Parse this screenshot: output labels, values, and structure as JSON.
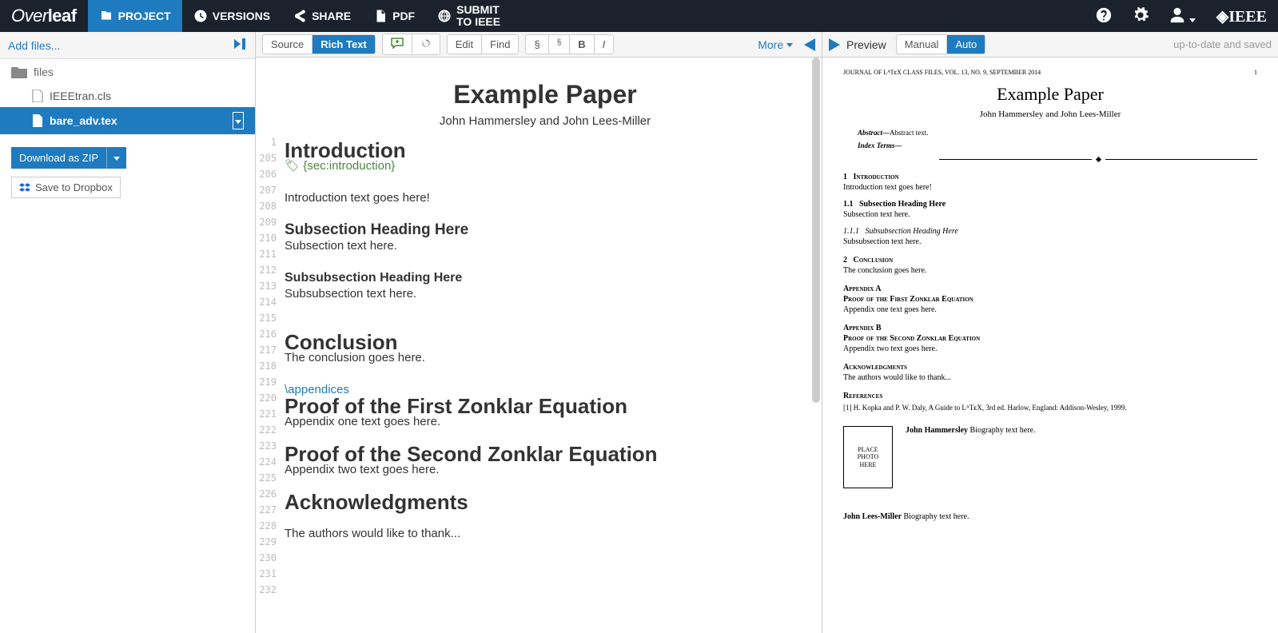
{
  "logo_thin": "Over",
  "logo_bold": "leaf",
  "nav": {
    "project": "PROJECT",
    "versions": "VERSIONS",
    "share": "SHARE",
    "pdf": "PDF",
    "submit1": "SUBMIT",
    "submit2": "TO IEEE"
  },
  "ieee": "◈IEEE",
  "sidebar": {
    "add": "Add files...",
    "folder": "files",
    "f1": "IEEEtran.cls",
    "f2": "bare_adv.tex",
    "zip": "Download as ZIP",
    "dropbox": "Save to Dropbox"
  },
  "tb": {
    "source": "Source",
    "rich": "Rich Text",
    "edit": "Edit",
    "find": "Find",
    "sec": "§",
    "sub": "§",
    "b": "B",
    "i": "I",
    "more": "More"
  },
  "gut": [
    "1",
    "205",
    "206",
    "207",
    "208",
    "209",
    "210",
    "211",
    "212",
    "213",
    "214",
    "215",
    "216",
    "217",
    "218",
    "219",
    "220",
    "221",
    "222",
    "223",
    "224",
    "225",
    "226",
    "227",
    "228",
    "229",
    "230",
    "231",
    "232"
  ],
  "ed": {
    "title": "Example Paper",
    "authors": "John Hammersley and John Lees-Miller",
    "intro_h": "Introduction",
    "intro_tag": "{sec:introduction}",
    "intro_t": "Introduction text goes here!",
    "sub_h": "Subsection Heading Here",
    "sub_t": "Subsection text here.",
    "subsub_h": "Subsubsection Heading Here",
    "subsub_t": "Subsubsection text here.",
    "conc_h": "Conclusion",
    "conc_t": "The conclusion goes here.",
    "app_cmd": "\\appendices",
    "z1_h": "Proof of the First Zonklar Equation",
    "z1_t": "Appendix one text goes here.",
    "z2_h": "Proof of the Second Zonklar Equation",
    "z2_t": "Appendix two text goes here.",
    "ack_h": "Acknowledgments",
    "ack_t": "The authors would like to thank..."
  },
  "prev": {
    "label": "Preview",
    "manual": "Manual",
    "auto": "Auto",
    "status": "up-to-date and saved"
  },
  "pdf": {
    "journal": "JOURNAL OF LᴬTᴇX CLASS FILES, VOL. 13, NO. 9, SEPTEMBER 2014",
    "page": "1",
    "title": "Example Paper",
    "authors": "John Hammersley and John Lees-Miller",
    "abs_l": "Abstract—",
    "abs_t": "Abstract text.",
    "idx_l": "Index Terms—",
    "s1": "1",
    "s1t": "Introduction",
    "s1b": "Introduction text goes here!",
    "s11": "1.1",
    "s11t": "Subsection Heading Here",
    "s11b": "Subsection text here.",
    "s111": "1.1.1",
    "s111t": "Subsubsection Heading Here",
    "s111b": "Subsubsection text here.",
    "s2": "2",
    "s2t": "Conclusion",
    "s2b": "The conclusion goes here.",
    "aA": "Appendix A",
    "aAt": "Proof of the First Zonklar Equation",
    "aAb": "Appendix one text goes here.",
    "aB": "Appendix B",
    "aBt": "Proof of the Second Zonklar Equation",
    "aBb": "Appendix two text goes here.",
    "ack": "Acknowledgments",
    "ackb": "The authors would like to thank...",
    "ref": "References",
    "ref1": "[1]  H. Kopka and P. W. Daly, A Guide to LᴬTᴇX, 3rd ed.  Harlow, England: Addison-Wesley, 1999.",
    "photo": "PLACE\nPHOTO\nHERE",
    "bio1n": "John Hammersley",
    "bio1t": " Biography text here.",
    "bio2n": "John Lees-Miller",
    "bio2t": " Biography text here."
  }
}
